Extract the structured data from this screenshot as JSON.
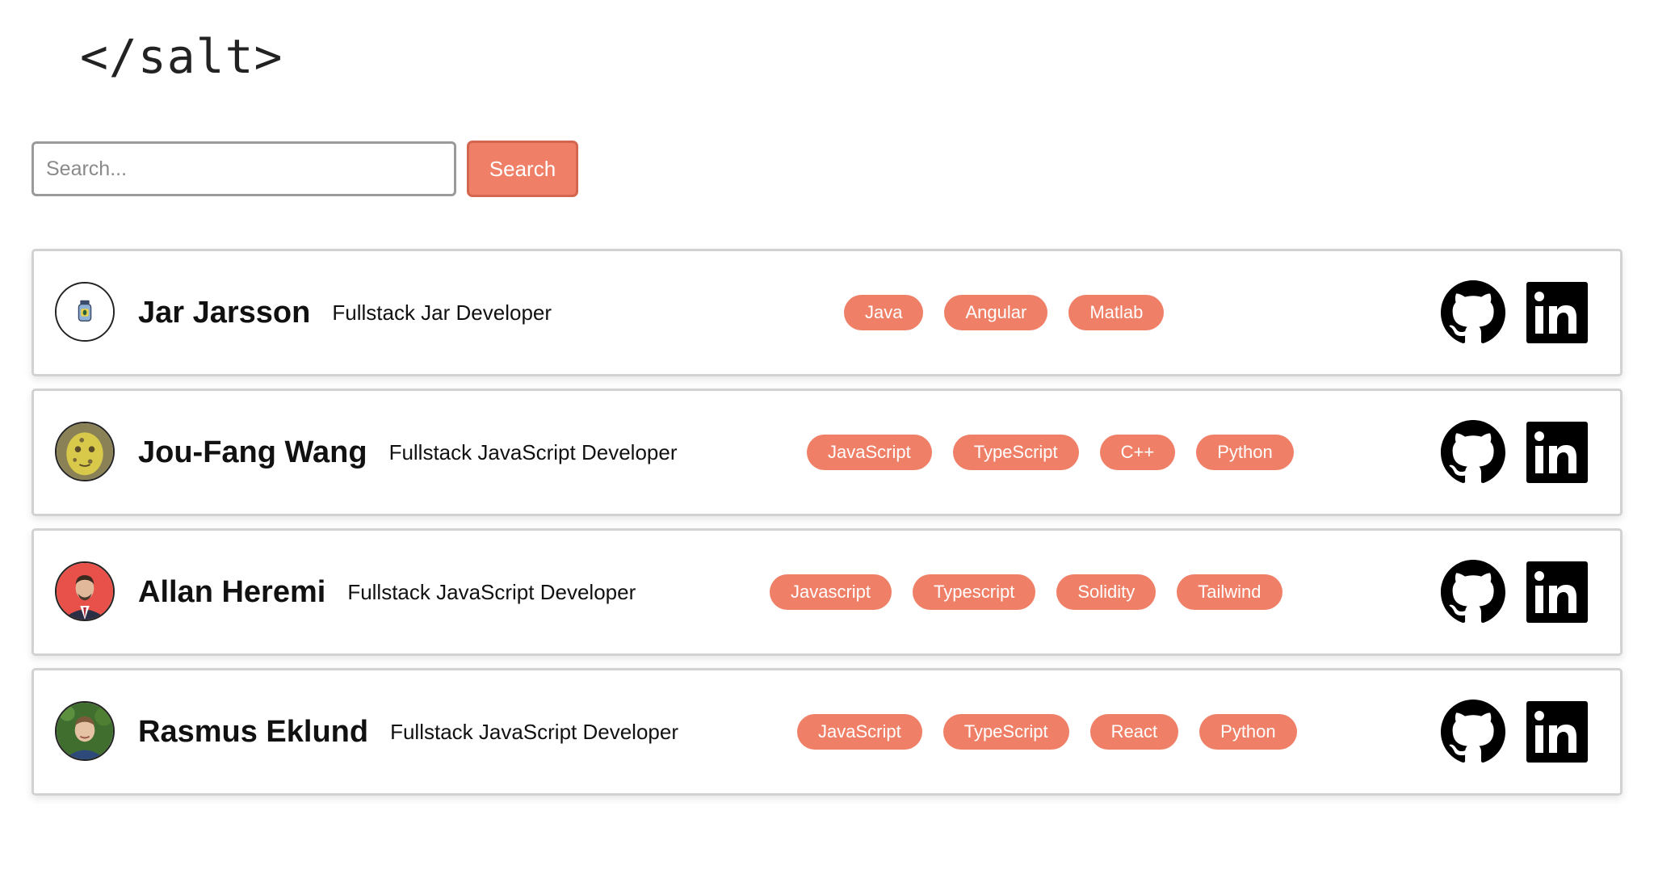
{
  "header": {
    "logo_text": "</salt>"
  },
  "search": {
    "placeholder": "Search...",
    "value": "",
    "button_label": "Search"
  },
  "colors": {
    "accent": "#ef8067",
    "card_border": "#d2d2d2"
  },
  "developers": [
    {
      "name": "Jar Jarsson",
      "role": "Fullstack Jar Developer",
      "avatar_icon": "jar-icon",
      "tags": [
        "Java",
        "Angular",
        "Matlab"
      ]
    },
    {
      "name": "Jou-Fang Wang",
      "role": "Fullstack JavaScript Developer",
      "avatar_icon": "photo-avatar",
      "tags": [
        "JavaScript",
        "TypeScript",
        "C++",
        "Python"
      ]
    },
    {
      "name": "Allan Heremi",
      "role": "Fullstack JavaScript Developer",
      "avatar_icon": "photo-avatar",
      "tags": [
        "Javascript",
        "Typescript",
        "Solidity",
        "Tailwind"
      ]
    },
    {
      "name": "Rasmus Eklund",
      "role": "Fullstack JavaScript Developer",
      "avatar_icon": "photo-avatar",
      "tags": [
        "JavaScript",
        "TypeScript",
        "React",
        "Python"
      ]
    }
  ],
  "social_icons": [
    "github-icon",
    "linkedin-icon"
  ]
}
